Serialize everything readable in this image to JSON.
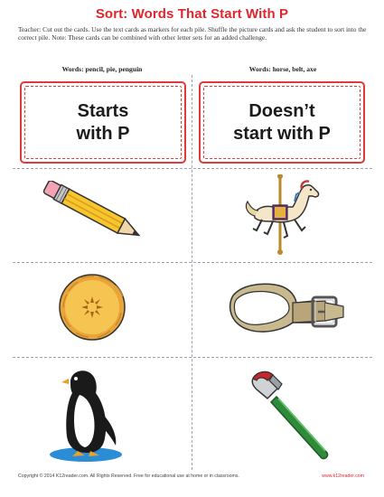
{
  "title": "Sort: Words That Start With P",
  "instructions": "Teacher: Cut out the cards. Use the text cards as markers for each pile. Shuffle the picture cards and ask the student to sort into the correct pile. Note: These cards can be combined with other letter sets for an added challenge.",
  "columns": {
    "left_header": "Words: pencil, pie, penguin",
    "right_header": "Words: horse, belt, axe"
  },
  "cards": {
    "starts_line1": "Starts",
    "starts_line2": "with P",
    "doesnt_line1": "Doesn’t",
    "doesnt_line2": "start with P"
  },
  "pictures": {
    "left": [
      "pencil-icon",
      "pie-icon",
      "penguin-icon"
    ],
    "right": [
      "carousel-horse-icon",
      "belt-icon",
      "axe-icon"
    ]
  },
  "colors": {
    "accent": "#e0262d",
    "divider": "#9aa3ad"
  },
  "footer": {
    "copyright": "Copyright © 2014  K12reader.com. All Rights Reserved. Free for educational use at home or in classrooms.",
    "site": "www.k12reader.com"
  }
}
